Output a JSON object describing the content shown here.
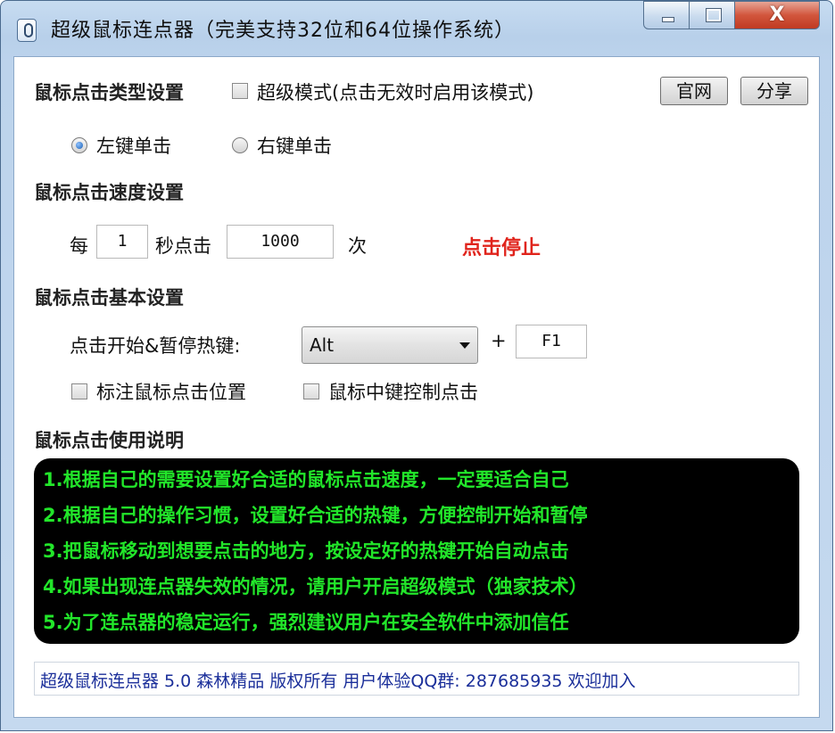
{
  "window": {
    "title": "超级鼠标连点器（完美支持32位和64位操作系统）",
    "close_glyph": "X"
  },
  "type_settings": {
    "heading": "鼠标点击类型设置",
    "super_mode_label": "超级模式(点击无效时启用该模式)",
    "super_mode_checked": false,
    "official_site_button": "官网",
    "share_button": "分享",
    "left_click_label": "左键单击",
    "right_click_label": "右键单击",
    "selected": "左键单击"
  },
  "speed_settings": {
    "heading": "鼠标点击速度设置",
    "every_label": "每",
    "seconds_value": "1",
    "seconds_label": "秒点击",
    "clicks_value": "1000",
    "times_label": "次",
    "status_text": "点击停止",
    "status_color": "#e0241c"
  },
  "basic_settings": {
    "heading": "鼠标点击基本设置",
    "hotkey_label": "点击开始&暂停热键:",
    "modifier_value": "Alt",
    "plus_label": "+",
    "key_value": "F1",
    "mark_position_label": "标注鼠标点击位置",
    "mark_position_checked": false,
    "middle_button_label": "鼠标中键控制点击",
    "middle_button_checked": false
  },
  "usage": {
    "heading": "鼠标点击使用说明",
    "tips": [
      "1.根据自己的需要设置好合适的鼠标点击速度，一定要适合自己",
      "2.根据自己的操作习惯，设置好合适的热键，方便控制开始和暂停",
      "3.把鼠标移动到想要点击的地方，按设定好的热键开始自动点击",
      "4.如果出现连点器失效的情况，请用户开启超级模式（独家技术）",
      "5.为了连点器的稳定运行，强烈建议用户在安全软件中添加信任"
    ],
    "tip_color": "#22e62a"
  },
  "footer": {
    "text": "超级鼠标连点器 5.0 森林精品 版权所有 用户体验QQ群: 287685935 欢迎加入"
  }
}
